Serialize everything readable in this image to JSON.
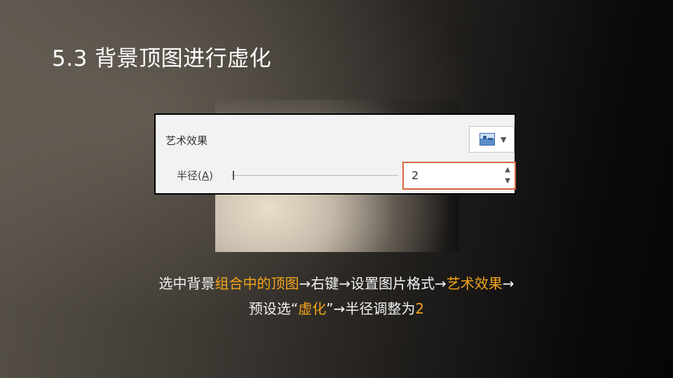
{
  "slide": {
    "title": "5.3 背景顶图进行虚化"
  },
  "panel": {
    "section_label": "艺术效果",
    "effect_icon": "artistic-effect-thumbnail-icon",
    "dropdown_icon": "chevron-down-icon",
    "radius_label_prefix": "半径(",
    "radius_label_key": "A",
    "radius_label_suffix": ")",
    "radius_value": "2",
    "accent_color": "#d7663e"
  },
  "caption": {
    "line1": [
      {
        "text": "选中背景",
        "highlight": false
      },
      {
        "text": "组合中的顶图",
        "highlight": true
      },
      {
        "text": "→右键→设置图片格式→",
        "highlight": false
      },
      {
        "text": "艺术效果",
        "highlight": true
      },
      {
        "text": "→",
        "highlight": false
      }
    ],
    "line2": [
      {
        "text": "预设选“",
        "highlight": false
      },
      {
        "text": "虚化",
        "highlight": true
      },
      {
        "text": "”→半径调整为",
        "highlight": false
      },
      {
        "text": "2",
        "highlight": true
      }
    ],
    "highlight_color": "#f3a51a"
  }
}
